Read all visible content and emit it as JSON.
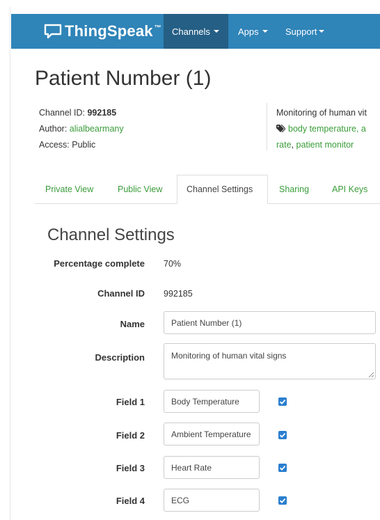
{
  "navbar": {
    "brand": "ThingSpeak",
    "brand_tm": "™",
    "items": [
      {
        "label": "Channels"
      },
      {
        "label": "Apps"
      },
      {
        "label": "Support"
      }
    ]
  },
  "channel": {
    "title": "Patient Number (1)",
    "id_label": "Channel ID: ",
    "id_value": "992185",
    "author_label": "Author: ",
    "author_value": "alialbearmany",
    "access_label": "Access: ",
    "access_value": "Public",
    "description_preview": "Monitoring of human vit",
    "tags_line1": "body temperature, a",
    "tags_line2_link1": "rate",
    "tags_line2_sep": ", ",
    "tags_line2_link2": "patient monitor"
  },
  "tabs": [
    {
      "label": "Private View"
    },
    {
      "label": "Public View"
    },
    {
      "label": "Channel Settings"
    },
    {
      "label": "Sharing"
    },
    {
      "label": "API Keys"
    }
  ],
  "settings": {
    "title": "Channel Settings",
    "percentage_label": "Percentage complete",
    "percentage_value": "70%",
    "channel_id_label": "Channel ID",
    "channel_id_value": "992185",
    "name_label": "Name",
    "name_value": "Patient Number (1)",
    "description_label": "Description",
    "description_value": "Monitoring of human vital signs",
    "fields": [
      {
        "label": "Field 1",
        "value": "Body Temperature",
        "checked": true
      },
      {
        "label": "Field 2",
        "value": "Ambient Temperature",
        "checked": true
      },
      {
        "label": "Field 3",
        "value": "Heart Rate",
        "checked": true
      },
      {
        "label": "Field 4",
        "value": "ECG",
        "checked": true
      }
    ]
  },
  "colors": {
    "nav_bg": "#2f84b8",
    "nav_active": "#255f85",
    "link_green": "#3a9c3a",
    "checkbox_blue": "#2a7fcf"
  }
}
